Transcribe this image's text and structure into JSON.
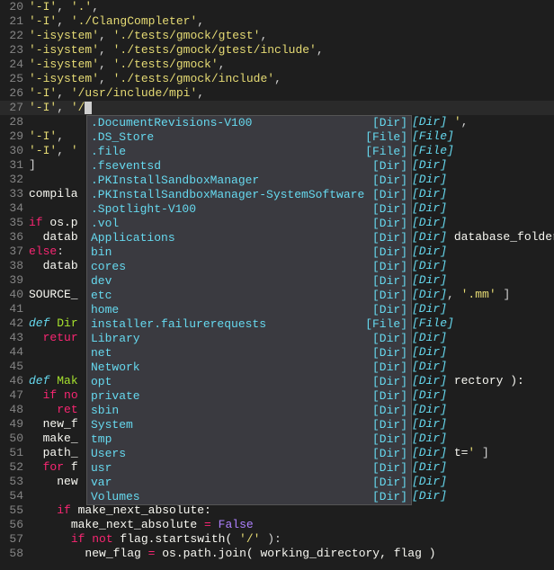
{
  "lines": [
    {
      "n": 20,
      "tokens": [
        [
          "'-I'",
          "str"
        ],
        [
          ", ",
          "punct"
        ],
        [
          "'.'",
          "str"
        ],
        [
          ",",
          "punct"
        ]
      ]
    },
    {
      "n": 21,
      "tokens": [
        [
          "'-I'",
          "str"
        ],
        [
          ", ",
          "punct"
        ],
        [
          "'./ClangCompleter'",
          "str"
        ],
        [
          ",",
          "punct"
        ]
      ]
    },
    {
      "n": 22,
      "tokens": [
        [
          "'-isystem'",
          "str"
        ],
        [
          ", ",
          "punct"
        ],
        [
          "'./tests/gmock/gtest'",
          "str"
        ],
        [
          ",",
          "punct"
        ]
      ]
    },
    {
      "n": 23,
      "tokens": [
        [
          "'-isystem'",
          "str"
        ],
        [
          ", ",
          "punct"
        ],
        [
          "'./tests/gmock/gtest/include'",
          "str"
        ],
        [
          ",",
          "punct"
        ]
      ]
    },
    {
      "n": 24,
      "tokens": [
        [
          "'-isystem'",
          "str"
        ],
        [
          ", ",
          "punct"
        ],
        [
          "'./tests/gmock'",
          "str"
        ],
        [
          ",",
          "punct"
        ]
      ]
    },
    {
      "n": 25,
      "tokens": [
        [
          "'-isystem'",
          "str"
        ],
        [
          ", ",
          "punct"
        ],
        [
          "'./tests/gmock/include'",
          "str"
        ],
        [
          ",",
          "punct"
        ]
      ]
    },
    {
      "n": 26,
      "tokens": [
        [
          "'-I'",
          "str"
        ],
        [
          ", ",
          "punct"
        ],
        [
          "'/usr/include/mpi'",
          "str"
        ],
        [
          ",",
          "punct"
        ]
      ]
    },
    {
      "n": 27,
      "current": true,
      "tokens": [
        [
          "'-I'",
          "str"
        ],
        [
          ", ",
          "punct"
        ],
        [
          "'/",
          "str"
        ]
      ],
      "cursor": true
    },
    {
      "n": 28,
      "right": "[Dir] ',",
      "rightTokens": [
        [
          "[Dir]",
          "def"
        ],
        [
          " ",
          "punct"
        ],
        [
          "'",
          "str"
        ],
        [
          ",",
          "punct"
        ]
      ]
    },
    {
      "n": 29,
      "tokens": [
        [
          "'-I'",
          "str"
        ],
        [
          ", ",
          "punct"
        ]
      ],
      "right": "[File]",
      "rightTokens": [
        [
          "[File]",
          "def"
        ]
      ]
    },
    {
      "n": 30,
      "tokens": [
        [
          "'-I'",
          "str"
        ],
        [
          ", ",
          "punct"
        ],
        [
          "'",
          "str"
        ]
      ],
      "right": "[File]",
      "rightTokens": [
        [
          "[File]",
          "def"
        ]
      ]
    },
    {
      "n": 31,
      "tokens": [
        [
          "]",
          "punct"
        ]
      ],
      "right": "[Dir]",
      "rightTokens": [
        [
          "[Dir]",
          "def"
        ]
      ]
    },
    {
      "n": 32,
      "right": "[Dir]",
      "rightTokens": [
        [
          "[Dir]",
          "def"
        ]
      ]
    },
    {
      "n": 33,
      "tokens": [
        [
          "compila",
          "id"
        ]
      ],
      "right": "[Dir]",
      "rightTokens": [
        [
          "[Dir]",
          "def"
        ]
      ]
    },
    {
      "n": 34,
      "right": "[Dir]",
      "rightTokens": [
        [
          "[Dir]",
          "def"
        ]
      ]
    },
    {
      "n": 35,
      "tokens": [
        [
          "if ",
          "kw"
        ],
        [
          "os.p",
          "id"
        ]
      ],
      "right": "[Dir]",
      "rightTokens": [
        [
          "[Dir]",
          "def"
        ]
      ]
    },
    {
      "n": 36,
      "indent": 2,
      "tokens": [
        [
          "datab",
          "id"
        ]
      ],
      "right": "[Dir]",
      "rightTokens": [
        [
          "[Dir]",
          "def"
        ]
      ],
      "after": " database_folder )"
    },
    {
      "n": 37,
      "tokens": [
        [
          "else",
          "kw"
        ],
        [
          ":",
          "punct"
        ]
      ],
      "right": "[Dir]",
      "rightTokens": [
        [
          "[Dir]",
          "def"
        ]
      ]
    },
    {
      "n": 38,
      "indent": 2,
      "tokens": [
        [
          "datab",
          "id"
        ]
      ],
      "right": "[Dir]",
      "rightTokens": [
        [
          "[Dir]",
          "def"
        ]
      ]
    },
    {
      "n": 39,
      "right": "[Dir]",
      "rightTokens": [
        [
          "[Dir]",
          "def"
        ]
      ]
    },
    {
      "n": 40,
      "tokens": [
        [
          "SOURCE_",
          "id"
        ]
      ],
      "right": "[Dir]",
      "rightTokens": [
        [
          "[Dir]",
          "def"
        ]
      ],
      "after": ", '.mm' ]",
      "afterTokens": [
        [
          ", ",
          "punct"
        ],
        [
          "'.mm'",
          "str"
        ],
        [
          " ]",
          "punct"
        ]
      ]
    },
    {
      "n": 41,
      "right": "[Dir]",
      "rightTokens": [
        [
          "[Dir]",
          "def"
        ]
      ]
    },
    {
      "n": 42,
      "tokens": [
        [
          "def ",
          "def"
        ],
        [
          "Dir",
          "name"
        ]
      ],
      "right": "[File]",
      "rightTokens": [
        [
          "[File]",
          "def"
        ]
      ]
    },
    {
      "n": 43,
      "indent": 2,
      "tokens": [
        [
          "retur",
          "kw"
        ]
      ],
      "right": "[Dir]",
      "rightTokens": [
        [
          "[Dir]",
          "def"
        ]
      ]
    },
    {
      "n": 44,
      "right": "[Dir]",
      "rightTokens": [
        [
          "[Dir]",
          "def"
        ]
      ]
    },
    {
      "n": 45,
      "right": "[Dir]",
      "rightTokens": [
        [
          "[Dir]",
          "def"
        ]
      ]
    },
    {
      "n": 46,
      "tokens": [
        [
          "def ",
          "def"
        ],
        [
          "Mak",
          "name"
        ]
      ],
      "right": "[Dir]",
      "rightTokens": [
        [
          "[Dir]",
          "def"
        ]
      ],
      "after": " rectory ):"
    },
    {
      "n": 47,
      "indent": 2,
      "tokens": [
        [
          "if ",
          "kw"
        ],
        [
          "no",
          "kw"
        ]
      ],
      "right": "[Dir]",
      "rightTokens": [
        [
          "[Dir]",
          "def"
        ]
      ]
    },
    {
      "n": 48,
      "indent": 4,
      "tokens": [
        [
          "ret",
          "kw"
        ]
      ],
      "right": "[Dir]",
      "rightTokens": [
        [
          "[Dir]",
          "def"
        ]
      ]
    },
    {
      "n": 49,
      "indent": 2,
      "tokens": [
        [
          "new_f",
          "id"
        ]
      ],
      "right": "[Dir]",
      "rightTokens": [
        [
          "[Dir]",
          "def"
        ]
      ]
    },
    {
      "n": 50,
      "indent": 2,
      "tokens": [
        [
          "make_",
          "id"
        ]
      ],
      "right": "[Dir]",
      "rightTokens": [
        [
          "[Dir]",
          "def"
        ]
      ]
    },
    {
      "n": 51,
      "indent": 2,
      "tokens": [
        [
          "path_",
          "id"
        ]
      ],
      "right": "[Dir]",
      "rightTokens": [
        [
          "[Dir]",
          "def"
        ]
      ],
      "after": " t=' ]",
      "afterTokens": [
        [
          " t=",
          "id"
        ],
        [
          "'",
          "str"
        ],
        [
          " ]",
          "punct"
        ]
      ]
    },
    {
      "n": 52,
      "indent": 2,
      "tokens": [
        [
          "for ",
          "kw"
        ],
        [
          "f",
          "id"
        ]
      ],
      "right": "[Dir]",
      "rightTokens": [
        [
          "[Dir]",
          "def"
        ]
      ]
    },
    {
      "n": 53,
      "indent": 4,
      "tokens": [
        [
          "new",
          "id"
        ]
      ],
      "right": "[Dir]",
      "rightTokens": [
        [
          "[Dir]",
          "def"
        ]
      ]
    },
    {
      "n": 54,
      "right": "[Dir]",
      "rightTokens": [
        [
          "[Dir]",
          "def"
        ]
      ]
    },
    {
      "n": 55,
      "indent": 4,
      "tokens": [
        [
          "if ",
          "kw"
        ],
        [
          "make_next_absolute:",
          "id"
        ]
      ]
    },
    {
      "n": 56,
      "indent": 6,
      "tokens": [
        [
          "make_next_absolute ",
          "id"
        ],
        [
          "=",
          "kw"
        ],
        [
          " ",
          "punct"
        ],
        [
          "False",
          "const"
        ]
      ]
    },
    {
      "n": 57,
      "indent": 6,
      "tokens": [
        [
          "if not ",
          "kw"
        ],
        [
          "flag.startswith( ",
          "id"
        ],
        [
          "'/'",
          "str"
        ],
        [
          " ):",
          "punct"
        ]
      ]
    },
    {
      "n": 58,
      "indent": 8,
      "tokens": [
        [
          "new_flag ",
          "id"
        ],
        [
          "=",
          "kw"
        ],
        [
          " os.path.join( working_directory, flag )",
          "id"
        ]
      ]
    }
  ],
  "popup": [
    {
      "name": ".DocumentRevisions-V100",
      "kind": "[Dir]"
    },
    {
      "name": ".DS_Store",
      "kind": "[File]"
    },
    {
      "name": ".file",
      "kind": "[File]"
    },
    {
      "name": ".fseventsd",
      "kind": "[Dir]"
    },
    {
      "name": ".PKInstallSandboxManager",
      "kind": "[Dir]"
    },
    {
      "name": ".PKInstallSandboxManager-SystemSoftware",
      "kind": "[Dir]"
    },
    {
      "name": ".Spotlight-V100",
      "kind": "[Dir]"
    },
    {
      "name": ".vol",
      "kind": "[Dir]"
    },
    {
      "name": "Applications",
      "kind": "[Dir]"
    },
    {
      "name": "bin",
      "kind": "[Dir]"
    },
    {
      "name": "cores",
      "kind": "[Dir]"
    },
    {
      "name": "dev",
      "kind": "[Dir]"
    },
    {
      "name": "etc",
      "kind": "[Dir]"
    },
    {
      "name": "home",
      "kind": "[Dir]"
    },
    {
      "name": "installer.failurerequests",
      "kind": "[File]"
    },
    {
      "name": "Library",
      "kind": "[Dir]"
    },
    {
      "name": "net",
      "kind": "[Dir]"
    },
    {
      "name": "Network",
      "kind": "[Dir]"
    },
    {
      "name": "opt",
      "kind": "[Dir]"
    },
    {
      "name": "private",
      "kind": "[Dir]"
    },
    {
      "name": "sbin",
      "kind": "[Dir]"
    },
    {
      "name": "System",
      "kind": "[Dir]"
    },
    {
      "name": "tmp",
      "kind": "[Dir]"
    },
    {
      "name": "Users",
      "kind": "[Dir]"
    },
    {
      "name": "usr",
      "kind": "[Dir]"
    },
    {
      "name": "var",
      "kind": "[Dir]"
    },
    {
      "name": "Volumes",
      "kind": "[Dir]"
    }
  ]
}
